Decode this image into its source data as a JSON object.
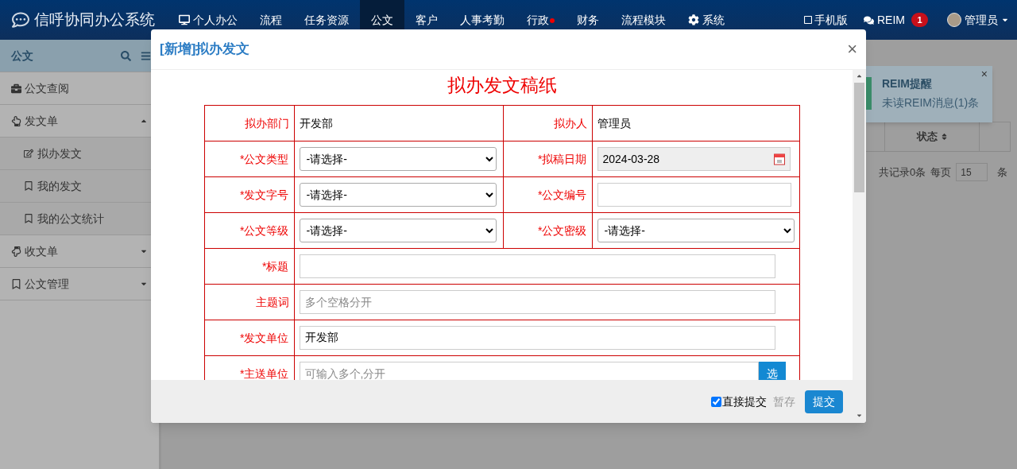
{
  "app": {
    "title": "信呼协同办公系统"
  },
  "nav": [
    {
      "label": "个人办公",
      "selected": false,
      "alert": false
    },
    {
      "label": "流程",
      "selected": false,
      "alert": false
    },
    {
      "label": "任务资源",
      "selected": false,
      "alert": false
    },
    {
      "label": "公文",
      "selected": true,
      "alert": false
    },
    {
      "label": "客户",
      "selected": false,
      "alert": false
    },
    {
      "label": "人事考勤",
      "selected": false,
      "alert": false
    },
    {
      "label": "行政",
      "selected": false,
      "alert": true
    },
    {
      "label": "财务",
      "selected": false,
      "alert": false
    },
    {
      "label": "流程模块",
      "selected": false,
      "alert": false
    },
    {
      "label": "系统",
      "selected": false,
      "alert": false
    }
  ],
  "nav_right": {
    "mobile": "手机版",
    "reim": "REIM",
    "reim_badge": "1",
    "user": "管理员"
  },
  "sidebar": {
    "title": "公文",
    "items": [
      {
        "label": "公文查阅"
      },
      {
        "label": "发文单",
        "expanded": true,
        "children": [
          {
            "label": "拟办发文"
          },
          {
            "label": "我的发文"
          },
          {
            "label": "我的公文统计"
          }
        ]
      },
      {
        "label": "收文单",
        "expanded": false
      },
      {
        "label": "公文管理",
        "expanded": false
      }
    ]
  },
  "table": {
    "columns": [
      "状态"
    ],
    "pager": {
      "total": "共记录0条",
      "per_page_label": "每页",
      "per_page": "15",
      "unit": "条"
    }
  },
  "toast": {
    "title": "REIM提醒",
    "message": "未读REIM消息(1)条",
    "close": "×"
  },
  "dialog": {
    "title": "[新增]拟办发文",
    "close": "×",
    "form_title": "拟办发文稿纸",
    "rows": [
      {
        "cells": [
          {
            "label": "拟办部门",
            "kind": "text",
            "value": "开发部"
          },
          {
            "label": "拟办人",
            "kind": "text",
            "value": "管理员"
          }
        ]
      },
      {
        "cells": [
          {
            "label": "*公文类型",
            "kind": "select",
            "value": "-请选择-"
          },
          {
            "label": "*拟稿日期",
            "kind": "date",
            "value": "2024-03-28"
          }
        ]
      },
      {
        "cells": [
          {
            "label": "*发文字号",
            "kind": "select",
            "value": "-请选择-"
          },
          {
            "label": "*公文编号",
            "kind": "input"
          }
        ]
      },
      {
        "cells": [
          {
            "label": "*公文等级",
            "kind": "select",
            "value": "-请选择-"
          },
          {
            "label": "*公文密级",
            "kind": "select",
            "value": "-请选择-"
          }
        ]
      },
      {
        "cells": [
          {
            "label": "*标题",
            "kind": "input"
          }
        ]
      },
      {
        "cells": [
          {
            "label": "主题词",
            "kind": "input",
            "placeholder": "多个空格分开"
          }
        ]
      },
      {
        "cells": [
          {
            "label": "*发文单位",
            "kind": "input",
            "value": "开发部"
          }
        ]
      },
      {
        "cells": [
          {
            "label": "*主送单位",
            "kind": "input_button",
            "placeholder": "可输入多个,分开",
            "button": "选"
          }
        ]
      }
    ],
    "footer": {
      "direct_submit": {
        "label": "直接提交",
        "checked": true
      },
      "draft": "暂存",
      "submit": "提交"
    }
  }
}
